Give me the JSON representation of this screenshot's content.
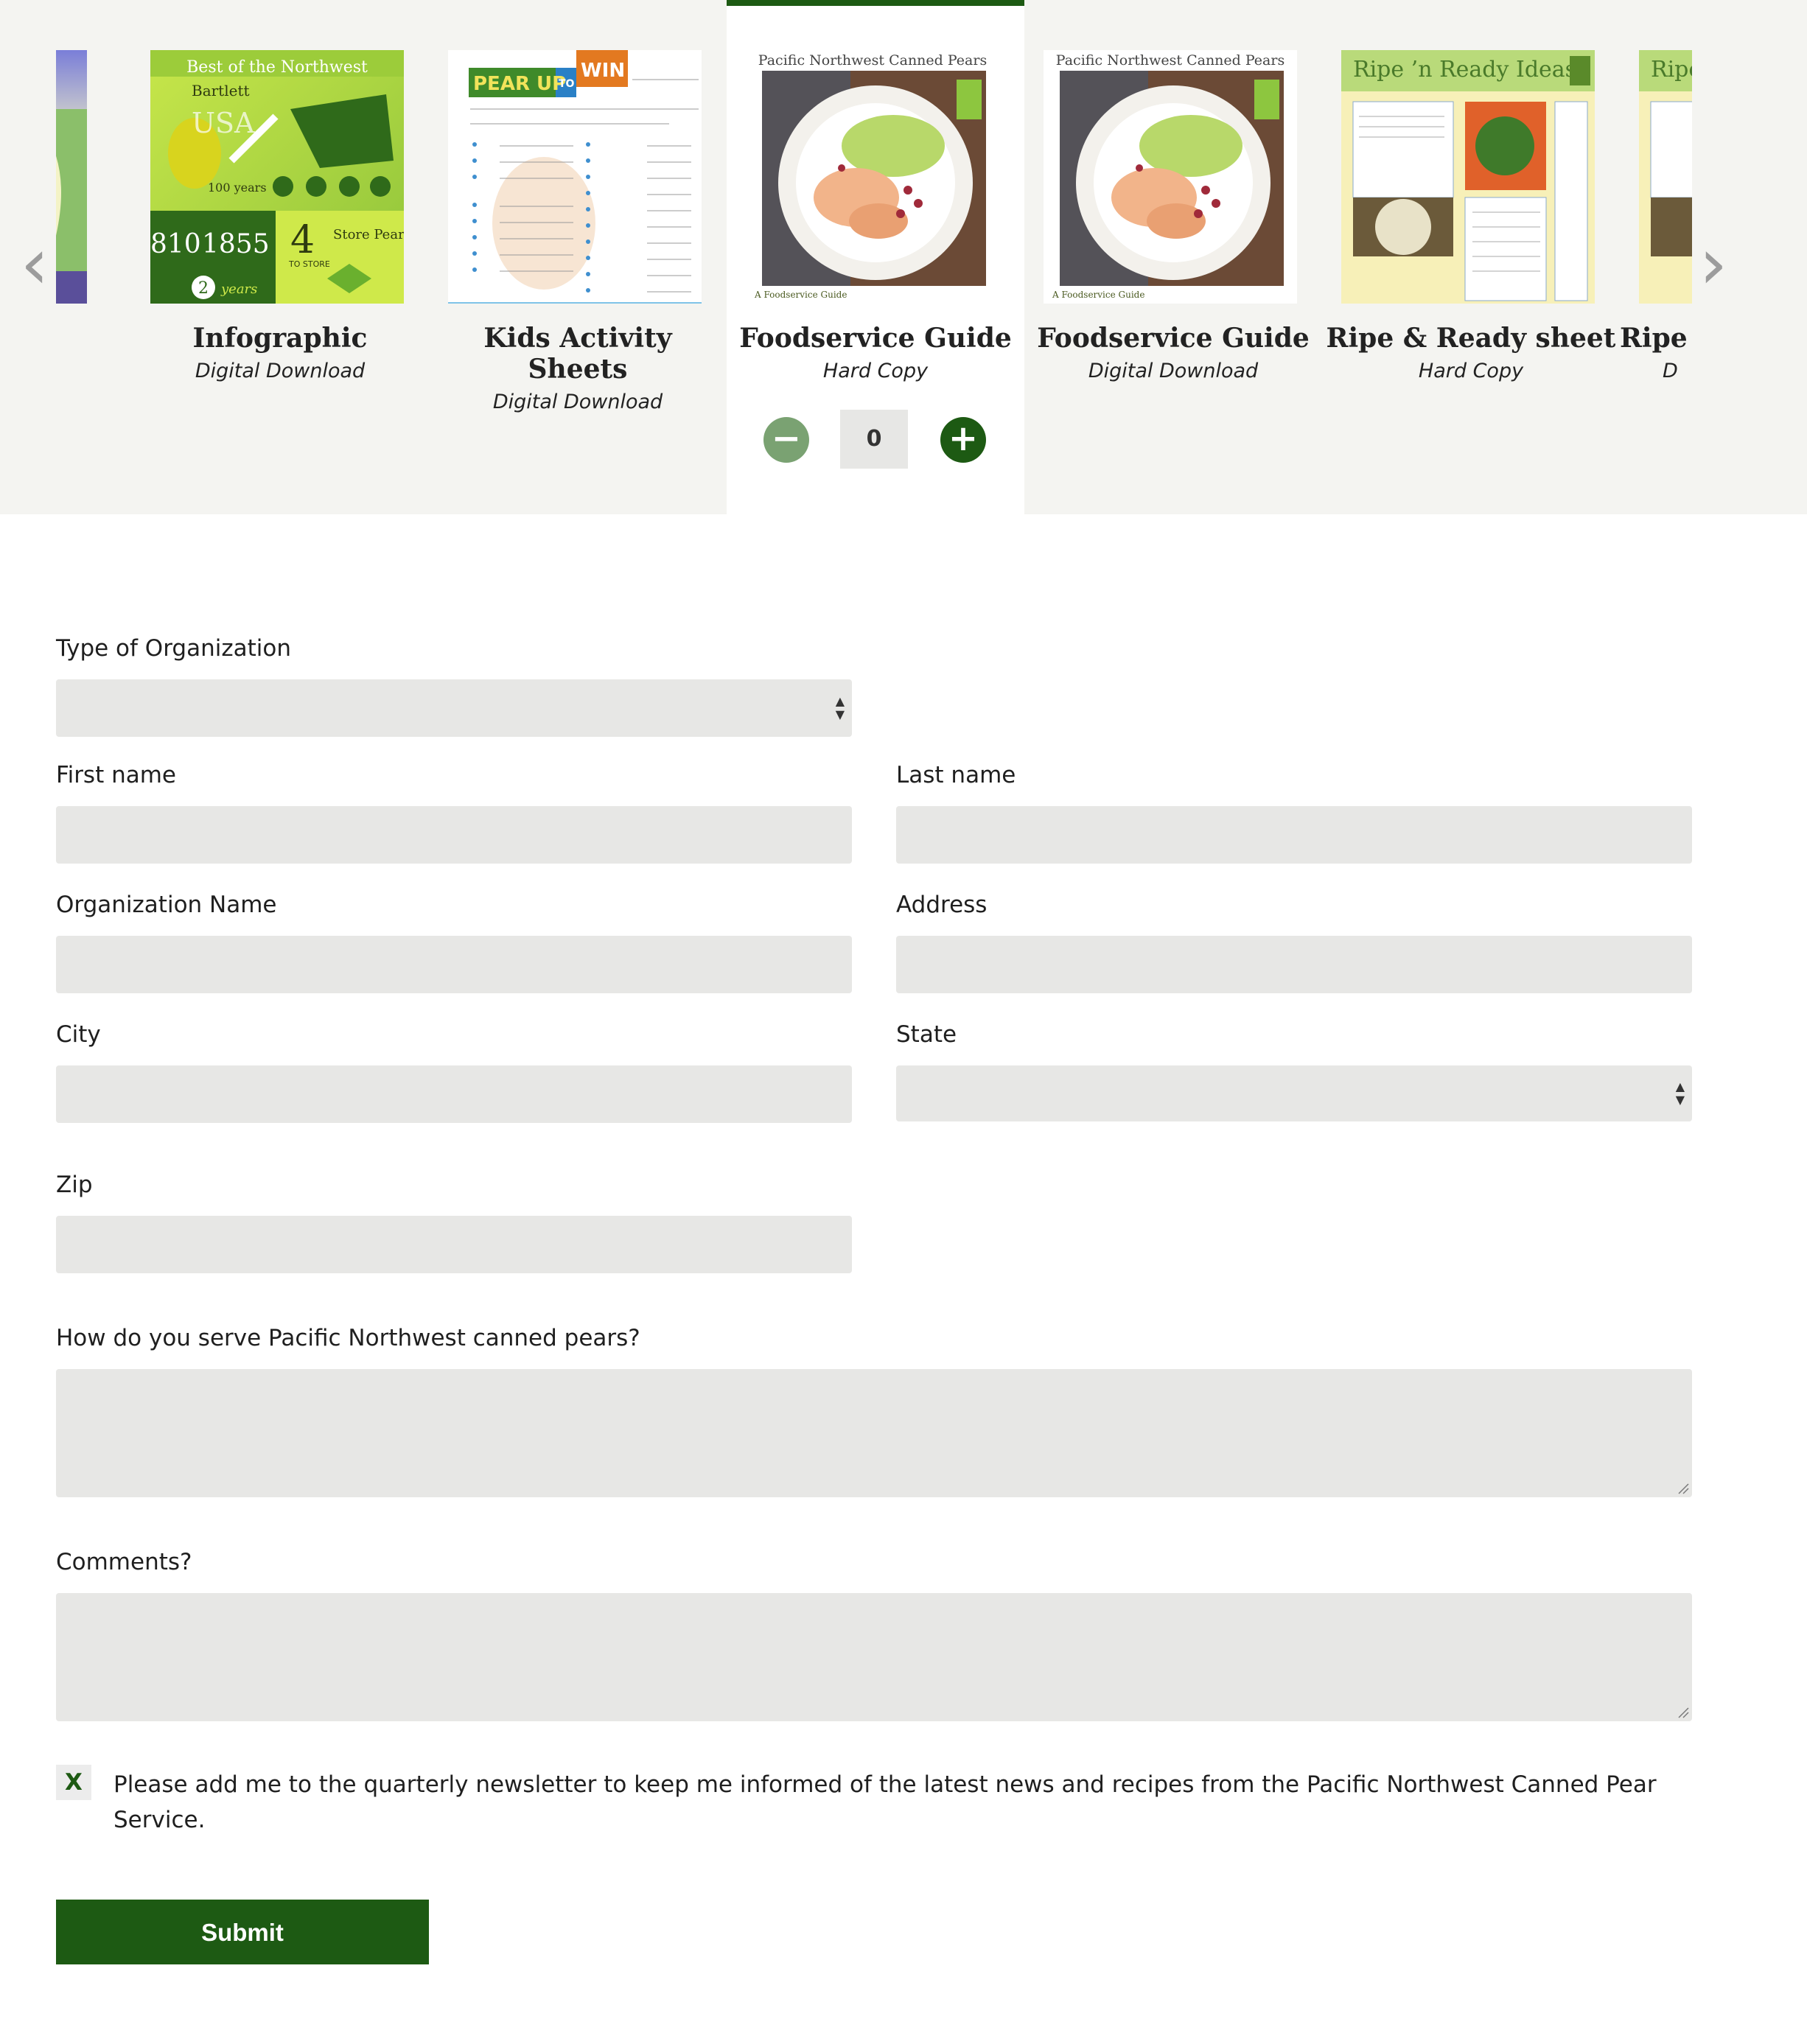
{
  "carousel": {
    "prev_icon": "chevron-left-icon",
    "next_icon": "chevron-right-icon",
    "items": [
      {
        "title": "Infographic",
        "subtitle": "Digital Download"
      },
      {
        "title": "Kids Activity Sheets",
        "title_line1": "Kids Activity",
        "title_line2": "Sheets",
        "subtitle": "Digital Download"
      },
      {
        "title": "Foodservice Guide",
        "subtitle": "Hard Copy",
        "quantity": "0",
        "thumb_header": "Pacific Northwest Canned Pears",
        "thumb_footer": "A Foodservice Guide"
      },
      {
        "title": "Foodservice Guide",
        "subtitle": "Digital Download",
        "thumb_header": "Pacific Northwest Canned Pears",
        "thumb_footer": "A Foodservice Guide"
      },
      {
        "title": "Ripe & Ready sheet",
        "subtitle": "Hard Copy",
        "thumb_header": "Ripe ’n Ready Ideas"
      },
      {
        "title": "Ripe",
        "subtitle": "D",
        "thumb_header": "Ripe"
      }
    ],
    "infographic": {
      "header": "Best of the Northwest",
      "bartlett": "Bartlett",
      "usa": "USA",
      "years": "100 years",
      "num1": "810",
      "num2": "1855",
      "num3": "4",
      "store": "Store Pears",
      "two": "2",
      "years2": "years",
      "to_store": "TO STORE"
    },
    "kids": {
      "pear_up": "PEAR UP",
      "to": "TO",
      "win": "WIN"
    }
  },
  "form": {
    "org_type_label": "Type of Organization",
    "first_name_label": "First name",
    "last_name_label": "Last name",
    "org_name_label": "Organization Name",
    "address_label": "Address",
    "city_label": "City",
    "state_label": "State",
    "zip_label": "Zip",
    "serve_label": "How do you serve Pacific Northwest canned pears?",
    "comments_label": "Comments?",
    "newsletter_mark": "X",
    "newsletter_text": "Please add me to the quarterly newsletter to keep me informed of the latest news and recipes from the Pacific Northwest Canned Pear Service.",
    "submit_label": "Submit"
  },
  "colors": {
    "accent": "#1d5a13",
    "field_bg": "#e7e7e5",
    "carousel_bg": "#f4f4f1",
    "minus": "#7aa272"
  }
}
